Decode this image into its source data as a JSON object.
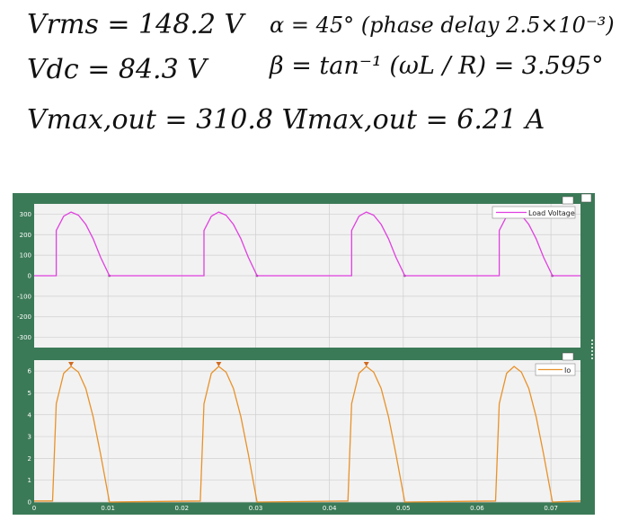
{
  "notes": {
    "line1_left": "Vrms = 148.2 V",
    "line1_right": "α = 45° (phase delay 2.5×10⁻³)",
    "line2_left": "Vdc = 84.3 V",
    "line2_right": "β = tan⁻¹ (ωL / R) = 3.595°",
    "line3_left": "Vmax,out = 310.8 V",
    "line3_right": "Imax,out = 6.21 A"
  },
  "colors": {
    "frame": "#3b7a57",
    "plot_bg": "#f2f2f2",
    "voltage": "#e040e0",
    "current": "#e8922a",
    "marker": "#d2691e"
  },
  "chart_data": [
    {
      "type": "line",
      "x": [
        0,
        0.003,
        0.003,
        0.004,
        0.005,
        0.006,
        0.007,
        0.008,
        0.009,
        0.0102,
        0.01,
        0.02,
        0.023,
        0.023,
        0.024,
        0.025,
        0.026,
        0.027,
        0.028,
        0.029,
        0.0302,
        0.03,
        0.04,
        0.043,
        0.043,
        0.044,
        0.045,
        0.046,
        0.047,
        0.048,
        0.049,
        0.0502,
        0.05,
        0.06,
        0.063,
        0.063,
        0.064,
        0.065,
        0.066,
        0.067,
        0.068,
        0.069,
        0.0702,
        0.07,
        0.074
      ],
      "series": [
        {
          "name": "Load Voltage",
          "values": [
            0,
            0,
            220,
            290,
            310,
            295,
            250,
            180,
            90,
            0,
            0,
            0,
            0,
            220,
            290,
            310,
            295,
            250,
            180,
            90,
            0,
            0,
            0,
            0,
            220,
            290,
            310,
            295,
            250,
            180,
            90,
            0,
            0,
            0,
            0,
            220,
            290,
            310,
            295,
            250,
            180,
            90,
            0,
            0,
            0
          ]
        }
      ],
      "xlim": [
        0,
        0.074
      ],
      "ylim": [
        -350,
        350
      ],
      "y_ticks": [
        "300",
        "200",
        "100",
        "0",
        "-100",
        "-200",
        "-300"
      ],
      "legend_position": "top-right",
      "grid": true
    },
    {
      "type": "line",
      "x": [
        0,
        0.0025,
        0.003,
        0.004,
        0.005,
        0.006,
        0.007,
        0.008,
        0.009,
        0.0102,
        0.0225,
        0.023,
        0.024,
        0.025,
        0.026,
        0.027,
        0.028,
        0.029,
        0.0302,
        0.0425,
        0.043,
        0.044,
        0.045,
        0.046,
        0.047,
        0.048,
        0.049,
        0.0502,
        0.0625,
        0.063,
        0.064,
        0.065,
        0.066,
        0.067,
        0.068,
        0.069,
        0.0702,
        0.074
      ],
      "series": [
        {
          "name": "Io",
          "values": [
            0.05,
            0.05,
            4.5,
            5.9,
            6.21,
            5.95,
            5.2,
            3.9,
            2.2,
            0,
            0.05,
            4.5,
            5.9,
            6.21,
            5.95,
            5.2,
            3.9,
            2.2,
            0,
            0.05,
            4.5,
            5.9,
            6.21,
            5.95,
            5.2,
            3.9,
            2.2,
            0,
            0.05,
            4.5,
            5.9,
            6.21,
            5.95,
            5.2,
            3.9,
            2.2,
            0,
            0.05
          ]
        }
      ],
      "xlim": [
        0,
        0.074
      ],
      "ylim": [
        0,
        6.5
      ],
      "y_ticks": [
        "6",
        "5",
        "4",
        "3",
        "2",
        "1",
        "0"
      ],
      "x_ticks": [
        "0",
        "0.01",
        "0.02",
        "0.03",
        "0.04",
        "0.05",
        "0.06",
        "0.07"
      ],
      "peak_markers_x": [
        0.005,
        0.025,
        0.045
      ],
      "legend_position": "top-right",
      "grid": true
    }
  ]
}
